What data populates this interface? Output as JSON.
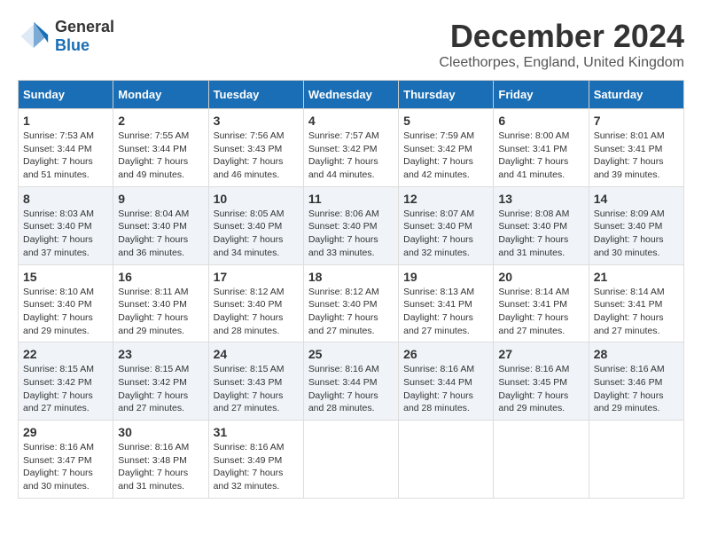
{
  "logo": {
    "general": "General",
    "blue": "Blue"
  },
  "header": {
    "month": "December 2024",
    "location": "Cleethorpes, England, United Kingdom"
  },
  "weekdays": [
    "Sunday",
    "Monday",
    "Tuesday",
    "Wednesday",
    "Thursday",
    "Friday",
    "Saturday"
  ],
  "weeks": [
    [
      {
        "day": "1",
        "sunrise": "Sunrise: 7:53 AM",
        "sunset": "Sunset: 3:44 PM",
        "daylight": "Daylight: 7 hours and 51 minutes."
      },
      {
        "day": "2",
        "sunrise": "Sunrise: 7:55 AM",
        "sunset": "Sunset: 3:44 PM",
        "daylight": "Daylight: 7 hours and 49 minutes."
      },
      {
        "day": "3",
        "sunrise": "Sunrise: 7:56 AM",
        "sunset": "Sunset: 3:43 PM",
        "daylight": "Daylight: 7 hours and 46 minutes."
      },
      {
        "day": "4",
        "sunrise": "Sunrise: 7:57 AM",
        "sunset": "Sunset: 3:42 PM",
        "daylight": "Daylight: 7 hours and 44 minutes."
      },
      {
        "day": "5",
        "sunrise": "Sunrise: 7:59 AM",
        "sunset": "Sunset: 3:42 PM",
        "daylight": "Daylight: 7 hours and 42 minutes."
      },
      {
        "day": "6",
        "sunrise": "Sunrise: 8:00 AM",
        "sunset": "Sunset: 3:41 PM",
        "daylight": "Daylight: 7 hours and 41 minutes."
      },
      {
        "day": "7",
        "sunrise": "Sunrise: 8:01 AM",
        "sunset": "Sunset: 3:41 PM",
        "daylight": "Daylight: 7 hours and 39 minutes."
      }
    ],
    [
      {
        "day": "8",
        "sunrise": "Sunrise: 8:03 AM",
        "sunset": "Sunset: 3:40 PM",
        "daylight": "Daylight: 7 hours and 37 minutes."
      },
      {
        "day": "9",
        "sunrise": "Sunrise: 8:04 AM",
        "sunset": "Sunset: 3:40 PM",
        "daylight": "Daylight: 7 hours and 36 minutes."
      },
      {
        "day": "10",
        "sunrise": "Sunrise: 8:05 AM",
        "sunset": "Sunset: 3:40 PM",
        "daylight": "Daylight: 7 hours and 34 minutes."
      },
      {
        "day": "11",
        "sunrise": "Sunrise: 8:06 AM",
        "sunset": "Sunset: 3:40 PM",
        "daylight": "Daylight: 7 hours and 33 minutes."
      },
      {
        "day": "12",
        "sunrise": "Sunrise: 8:07 AM",
        "sunset": "Sunset: 3:40 PM",
        "daylight": "Daylight: 7 hours and 32 minutes."
      },
      {
        "day": "13",
        "sunrise": "Sunrise: 8:08 AM",
        "sunset": "Sunset: 3:40 PM",
        "daylight": "Daylight: 7 hours and 31 minutes."
      },
      {
        "day": "14",
        "sunrise": "Sunrise: 8:09 AM",
        "sunset": "Sunset: 3:40 PM",
        "daylight": "Daylight: 7 hours and 30 minutes."
      }
    ],
    [
      {
        "day": "15",
        "sunrise": "Sunrise: 8:10 AM",
        "sunset": "Sunset: 3:40 PM",
        "daylight": "Daylight: 7 hours and 29 minutes."
      },
      {
        "day": "16",
        "sunrise": "Sunrise: 8:11 AM",
        "sunset": "Sunset: 3:40 PM",
        "daylight": "Daylight: 7 hours and 29 minutes."
      },
      {
        "day": "17",
        "sunrise": "Sunrise: 8:12 AM",
        "sunset": "Sunset: 3:40 PM",
        "daylight": "Daylight: 7 hours and 28 minutes."
      },
      {
        "day": "18",
        "sunrise": "Sunrise: 8:12 AM",
        "sunset": "Sunset: 3:40 PM",
        "daylight": "Daylight: 7 hours and 27 minutes."
      },
      {
        "day": "19",
        "sunrise": "Sunrise: 8:13 AM",
        "sunset": "Sunset: 3:41 PM",
        "daylight": "Daylight: 7 hours and 27 minutes."
      },
      {
        "day": "20",
        "sunrise": "Sunrise: 8:14 AM",
        "sunset": "Sunset: 3:41 PM",
        "daylight": "Daylight: 7 hours and 27 minutes."
      },
      {
        "day": "21",
        "sunrise": "Sunrise: 8:14 AM",
        "sunset": "Sunset: 3:41 PM",
        "daylight": "Daylight: 7 hours and 27 minutes."
      }
    ],
    [
      {
        "day": "22",
        "sunrise": "Sunrise: 8:15 AM",
        "sunset": "Sunset: 3:42 PM",
        "daylight": "Daylight: 7 hours and 27 minutes."
      },
      {
        "day": "23",
        "sunrise": "Sunrise: 8:15 AM",
        "sunset": "Sunset: 3:42 PM",
        "daylight": "Daylight: 7 hours and 27 minutes."
      },
      {
        "day": "24",
        "sunrise": "Sunrise: 8:15 AM",
        "sunset": "Sunset: 3:43 PM",
        "daylight": "Daylight: 7 hours and 27 minutes."
      },
      {
        "day": "25",
        "sunrise": "Sunrise: 8:16 AM",
        "sunset": "Sunset: 3:44 PM",
        "daylight": "Daylight: 7 hours and 28 minutes."
      },
      {
        "day": "26",
        "sunrise": "Sunrise: 8:16 AM",
        "sunset": "Sunset: 3:44 PM",
        "daylight": "Daylight: 7 hours and 28 minutes."
      },
      {
        "day": "27",
        "sunrise": "Sunrise: 8:16 AM",
        "sunset": "Sunset: 3:45 PM",
        "daylight": "Daylight: 7 hours and 29 minutes."
      },
      {
        "day": "28",
        "sunrise": "Sunrise: 8:16 AM",
        "sunset": "Sunset: 3:46 PM",
        "daylight": "Daylight: 7 hours and 29 minutes."
      }
    ],
    [
      {
        "day": "29",
        "sunrise": "Sunrise: 8:16 AM",
        "sunset": "Sunset: 3:47 PM",
        "daylight": "Daylight: 7 hours and 30 minutes."
      },
      {
        "day": "30",
        "sunrise": "Sunrise: 8:16 AM",
        "sunset": "Sunset: 3:48 PM",
        "daylight": "Daylight: 7 hours and 31 minutes."
      },
      {
        "day": "31",
        "sunrise": "Sunrise: 8:16 AM",
        "sunset": "Sunset: 3:49 PM",
        "daylight": "Daylight: 7 hours and 32 minutes."
      },
      null,
      null,
      null,
      null
    ]
  ]
}
